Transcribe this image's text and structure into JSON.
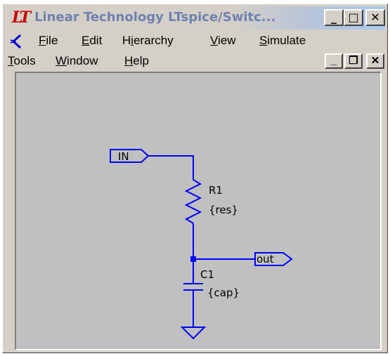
{
  "window": {
    "app_icon_text": "LT",
    "title": "Linear Technology LTspice/Switc...",
    "title_buttons": {
      "minimize": "_",
      "maximize": "□",
      "close": "✕"
    }
  },
  "menubar": {
    "items": [
      {
        "label": "File",
        "accel": "F",
        "rest": "ile"
      },
      {
        "label": "Edit",
        "accel": "E",
        "rest": "dit"
      },
      {
        "label": "Hierarchy",
        "pre": "H",
        "accel": "i",
        "rest": "erarchy"
      },
      {
        "label": "View",
        "accel": "V",
        "rest": "iew"
      },
      {
        "label": "Simulate",
        "accel": "S",
        "rest": "imulate"
      }
    ],
    "items2": [
      {
        "label": "Tools",
        "accel": "T",
        "rest": "ools"
      },
      {
        "label": "Window",
        "accel": "W",
        "rest": "indow"
      },
      {
        "label": "Help",
        "accel": "H",
        "rest": "elp"
      }
    ],
    "mdi_buttons": {
      "minimize": "_",
      "restore": "❐",
      "close": "✕"
    }
  },
  "schematic": {
    "input_port": "IN",
    "output_port": "out",
    "resistor": {
      "name": "R1",
      "value": "{res}"
    },
    "capacitor": {
      "name": "C1",
      "value": "{cap}"
    },
    "wire_color": "#0000ff"
  }
}
